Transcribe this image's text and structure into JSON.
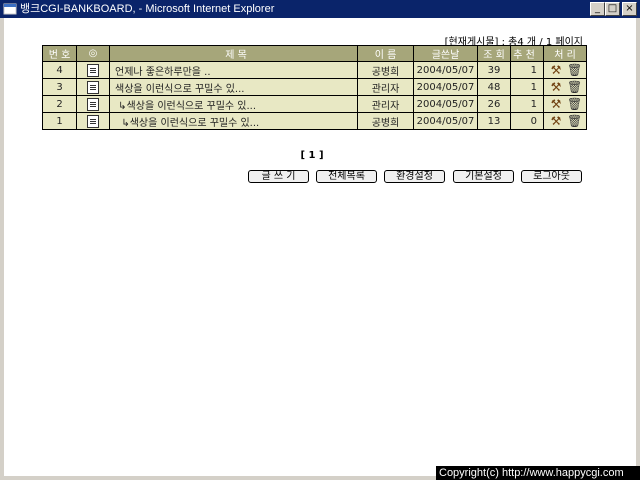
{
  "window": {
    "title": "뱅크CGI-BANKBOARD, - Microsoft Internet Explorer",
    "min_icon": "minimize-icon",
    "max_icon": "maximize-icon",
    "close_icon": "close-icon"
  },
  "board": {
    "count_text": "[현재게시물] : 총4 개 / 1 페이지",
    "headers": {
      "num": "번 호",
      "icon": "◎",
      "subject": "제                목",
      "name": "이 름",
      "date": "글쓴날",
      "views": "조 회",
      "recommend": "추 천",
      "process": "처 리"
    },
    "rows": [
      {
        "num": "4",
        "subject": "언제나 좋은하루만을 ..",
        "name": "공병희",
        "date": "2004/05/07",
        "views": "39",
        "recommend": "1"
      },
      {
        "num": "3",
        "subject": "색상을 이런식으로 꾸밀수 있...",
        "name": "관리자",
        "date": "2004/05/07",
        "views": "48",
        "recommend": "1"
      },
      {
        "num": "2",
        "subject": " ↳색상을 이런식으로 꾸밀수 있...",
        "name": "관리자",
        "date": "2004/05/07",
        "views": "26",
        "recommend": "1"
      },
      {
        "num": "1",
        "subject": "  ↳색상을 이런식으로 꾸밀수 있...",
        "name": "공병희",
        "date": "2004/05/07",
        "views": "13",
        "recommend": "0"
      }
    ],
    "pagination": "[ 1 ]"
  },
  "buttons": {
    "write": "글 쓰 기",
    "list": "전체목록",
    "env": "환경설정",
    "basic": "기본설정",
    "logout": "로그아웃"
  },
  "footer": {
    "copyright": "Copyright(c) http://www.happycgi.com"
  },
  "colors": {
    "titlebar": "#0a246a",
    "header_bg": "#a6a67a",
    "row_bg": "#e8e8c4"
  }
}
